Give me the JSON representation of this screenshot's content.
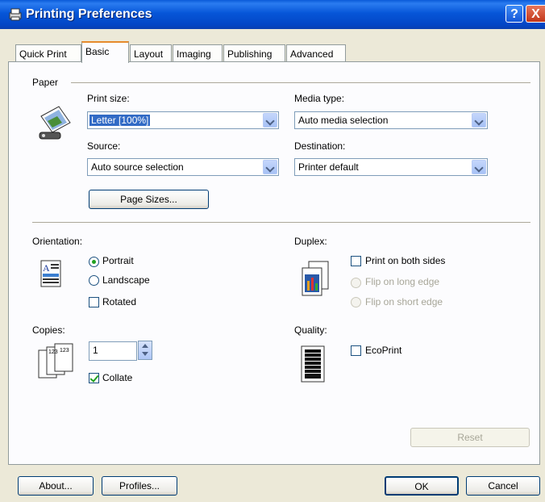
{
  "window": {
    "title": "Printing Preferences",
    "help": "?",
    "close": "X"
  },
  "tabs": [
    "Quick Print",
    "Basic",
    "Layout",
    "Imaging",
    "Publishing",
    "Advanced"
  ],
  "paper": {
    "group_label": "Paper",
    "print_size_label": "Print size:",
    "print_size_value": "Letter  [100%]",
    "media_type_label": "Media type:",
    "media_type_value": "Auto media selection",
    "source_label": "Source:",
    "source_value": "Auto source selection",
    "destination_label": "Destination:",
    "destination_value": "Printer default",
    "page_sizes_button": "Page Sizes..."
  },
  "orientation": {
    "label": "Orientation:",
    "portrait": "Portrait",
    "landscape": "Landscape",
    "rotated": "Rotated",
    "selected": "Portrait"
  },
  "duplex": {
    "label": "Duplex:",
    "print_both": "Print on both sides",
    "flip_long": "Flip on long edge",
    "flip_short": "Flip on short edge"
  },
  "copies": {
    "label": "Copies:",
    "value": "1",
    "collate": "Collate",
    "collate_checked": true
  },
  "quality": {
    "label": "Quality:",
    "ecoprint": "EcoPrint"
  },
  "buttons": {
    "reset": "Reset",
    "about": "About...",
    "profiles": "Profiles...",
    "ok": "OK",
    "cancel": "Cancel"
  }
}
